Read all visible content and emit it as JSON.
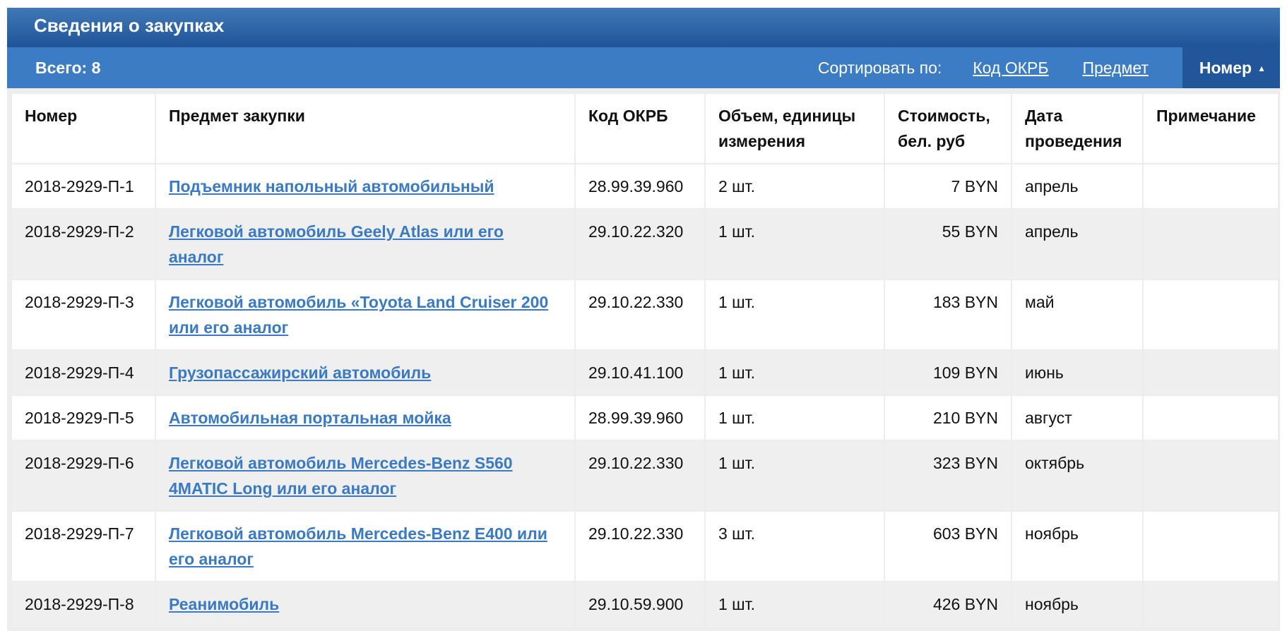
{
  "panel": {
    "title": "Сведения о закупках",
    "total_label": "Всего: 8",
    "sort_label": "Сортировать по:",
    "sort_options": [
      "Код ОКРБ",
      "Предмет"
    ],
    "sort_active": "Номер"
  },
  "table": {
    "headers": {
      "number": "Номер",
      "subject": "Предмет закупки",
      "okrb": "Код ОКРБ",
      "volume": "Объем, единицы измерения",
      "cost": "Стоимость, бел. руб",
      "date": "Дата проведения",
      "note": "Примечание"
    },
    "rows": [
      {
        "number": "2018-2929-П-1",
        "subject": "Подъемник напольный автомобильный",
        "okrb": "28.99.39.960",
        "volume": "2 шт.",
        "cost": "7 BYN",
        "date": "апрель",
        "note": ""
      },
      {
        "number": "2018-2929-П-2",
        "subject": "Легковой автомобиль Geely Atlas или его аналог",
        "okrb": "29.10.22.320",
        "volume": "1 шт.",
        "cost": "55 BYN",
        "date": "апрель",
        "note": ""
      },
      {
        "number": "2018-2929-П-3",
        "subject": "Легковой автомобиль «Toyota Land Cruiser 200 или его аналог",
        "okrb": "29.10.22.330",
        "volume": "1 шт.",
        "cost": "183 BYN",
        "date": "май",
        "note": ""
      },
      {
        "number": "2018-2929-П-4",
        "subject": "Грузопассажирский автомобиль",
        "okrb": "29.10.41.100",
        "volume": "1 шт.",
        "cost": "109 BYN",
        "date": "июнь",
        "note": ""
      },
      {
        "number": "2018-2929-П-5",
        "subject": "Автомобильная портальная мойка",
        "okrb": "28.99.39.960",
        "volume": "1 шт.",
        "cost": "210 BYN",
        "date": "август",
        "note": ""
      },
      {
        "number": "2018-2929-П-6",
        "subject": "Легковой автомобиль Mercedes-Benz S560 4MATIC Long или его аналог",
        "okrb": "29.10.22.330",
        "volume": "1 шт.",
        "cost": "323 BYN",
        "date": "октябрь",
        "note": ""
      },
      {
        "number": "2018-2929-П-7",
        "subject": "Легковой автомобиль Mercedes-Benz E400 или его аналог",
        "okrb": "29.10.22.330",
        "volume": "3 шт.",
        "cost": "603 BYN",
        "date": "ноябрь",
        "note": ""
      },
      {
        "number": "2018-2929-П-8",
        "subject": "Реанимобиль",
        "okrb": "29.10.59.900",
        "volume": "1 шт.",
        "cost": "426 BYN",
        "date": "ноябрь",
        "note": ""
      }
    ]
  },
  "colors": {
    "header_bar": "#2a62a5",
    "toolbar": "#3c7cc4",
    "active_sort": "#22569a",
    "link": "#3a7ac2"
  }
}
